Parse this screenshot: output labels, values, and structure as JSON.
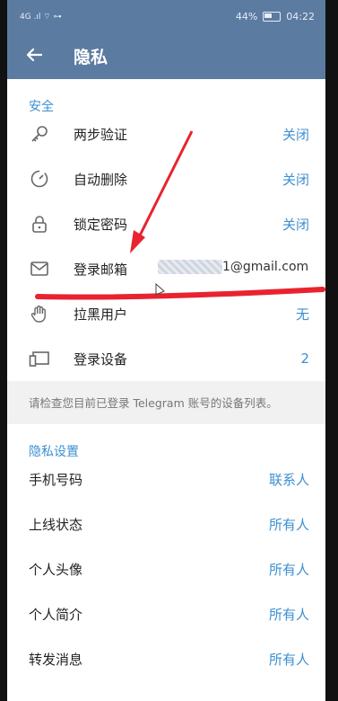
{
  "status": {
    "left": "4G .ıl ⌔ ⊶",
    "battery": "44%",
    "time": "04:22"
  },
  "appbar": {
    "title": "隐私"
  },
  "security": {
    "heading": "安全",
    "rows": [
      {
        "label": "两步验证",
        "value": "关闭",
        "icon": "key-icon"
      },
      {
        "label": "自动删除",
        "value": "关闭",
        "icon": "timer-icon"
      },
      {
        "label": "锁定密码",
        "value": "关闭",
        "icon": "lock-icon"
      },
      {
        "label": "登录邮箱",
        "value": "1@gmail.com",
        "icon": "mail-icon"
      },
      {
        "label": "拉黑用户",
        "value": "无",
        "icon": "hand-icon"
      },
      {
        "label": "登录设备",
        "value": "2",
        "icon": "devices-icon"
      }
    ],
    "hint": "请检查您目前已登录 Telegram 账号的设备列表。"
  },
  "privacy": {
    "heading": "隐私设置",
    "rows": [
      {
        "label": "手机号码",
        "value": "联系人"
      },
      {
        "label": "上线状态",
        "value": "所有人"
      },
      {
        "label": "个人头像",
        "value": "所有人"
      },
      {
        "label": "个人简介",
        "value": "所有人"
      },
      {
        "label": "转发消息",
        "value": "所有人"
      }
    ]
  },
  "colors": {
    "header": "#5b7ba1",
    "accent": "#3d8fd0",
    "annotation": "#e8232f"
  }
}
